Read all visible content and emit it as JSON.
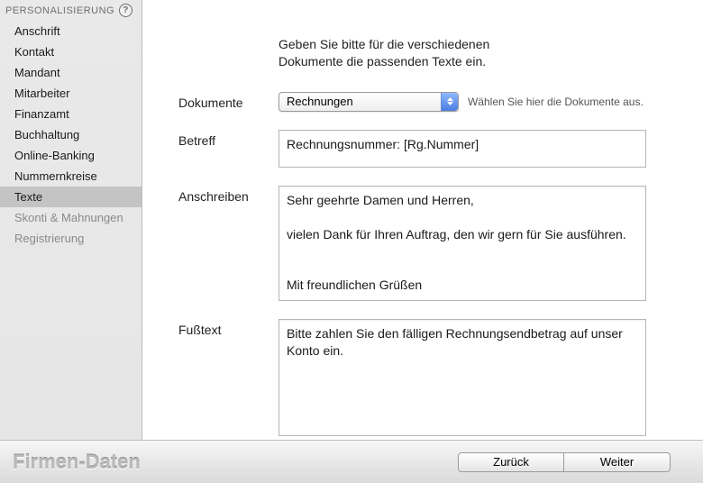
{
  "sidebar": {
    "header": "PERSONALISIERUNG",
    "items": [
      {
        "label": "Anschrift",
        "active": false,
        "disabled": false
      },
      {
        "label": "Kontakt",
        "active": false,
        "disabled": false
      },
      {
        "label": "Mandant",
        "active": false,
        "disabled": false
      },
      {
        "label": "Mitarbeiter",
        "active": false,
        "disabled": false
      },
      {
        "label": "Finanzamt",
        "active": false,
        "disabled": false
      },
      {
        "label": "Buchhaltung",
        "active": false,
        "disabled": false
      },
      {
        "label": "Online-Banking",
        "active": false,
        "disabled": false
      },
      {
        "label": "Nummernkreise",
        "active": false,
        "disabled": false
      },
      {
        "label": "Texte",
        "active": true,
        "disabled": false
      },
      {
        "label": "Skonti & Mahnungen",
        "active": false,
        "disabled": true
      },
      {
        "label": "Registrierung",
        "active": false,
        "disabled": true
      }
    ]
  },
  "content": {
    "intro_line1": "Geben Sie bitte für die verschiedenen",
    "intro_line2": "Dokumente die passenden Texte ein.",
    "labels": {
      "dokumente": "Dokumente",
      "betreff": "Betreff",
      "anschreiben": "Anschreiben",
      "fusstext": "Fußtext"
    },
    "dokumente": {
      "selected": "Rechnungen",
      "hint": "Wählen Sie hier die Dokumente aus."
    },
    "betreff": "Rechnungsnummer: [Rg.Nummer]",
    "anschreiben": "Sehr geehrte Damen und Herren,\n\nvielen Dank für Ihren Auftrag, den wir gern für Sie ausführen.\n\n\nMit freundlichen Grüßen",
    "fusstext": "Bitte zahlen Sie den fälligen Rechnungsendbetrag auf unser Konto ein."
  },
  "footer": {
    "title": "Firmen-Daten",
    "back": "Zurück",
    "next": "Weiter"
  }
}
